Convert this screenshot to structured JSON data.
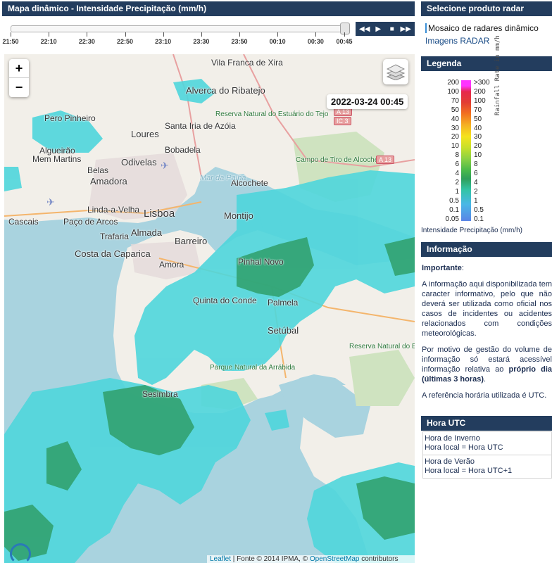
{
  "map_panel": {
    "title": "Mapa dinâmico - Intensidade Precipitação (mm/h)",
    "timeline_ticks": [
      "21:50",
      "22:10",
      "22:30",
      "22:50",
      "23:10",
      "23:30",
      "23:50",
      "00:10",
      "00:30",
      "00:45"
    ],
    "slider_position": 1.0,
    "player_buttons": [
      "rewind-icon",
      "play-icon",
      "stop-icon",
      "fast-forward-icon"
    ],
    "timestamp": "2022-03-24 00:45",
    "zoom_in": "+",
    "zoom_out": "−",
    "attribution": {
      "leaflet": "Leaflet",
      "sep1": " | Fonte © 2014 IPMA, © ",
      "osm": "OpenStreetMap",
      "tail": " contributors"
    },
    "places": {
      "vila_franca": "Vila Franca de Xira",
      "alverca": "Alverca do Ribatejo",
      "santa_iria": "Santa Iria de Azóia",
      "pero_pinheiro": "Pero Pinheiro",
      "loures": "Loures",
      "odivelas": "Odivelas",
      "bobadela": "Bobadela",
      "amadora": "Amadora",
      "algueirao": "Algueirão",
      "mem_martins": "Mem Martins",
      "belas": "Belas",
      "alcochete": "Alcochete",
      "lisboa": "Lisboa",
      "cascais": "Cascais",
      "paco_arcos": "Paço de Arcos",
      "linda_velha": "Linda-a-Velha",
      "trafaria": "Trafaria",
      "almada": "Almada",
      "montijo": "Montijo",
      "barreiro": "Barreiro",
      "costa_caparica": "Costa da Caparica",
      "amora": "Amora",
      "pinhal_novo": "Pinhal Novo",
      "quinta_conde": "Quinta do Conde",
      "palmela": "Palmela",
      "setubal": "Setúbal",
      "mar_palha": "Mar da Palha",
      "campo_tiro": "Campo de Tiro de Alcochete",
      "reserva_tejo": "Reserva Natural do Estuário do Tejo",
      "reserva_sado": "Reserva Natural do Estuário do Sado",
      "parque_arrabida": "Parque Natural da Arrábida",
      "sesimbra": "Sesimbra"
    },
    "road_shields": [
      "A 13",
      "IC 3",
      "A 13"
    ]
  },
  "product_panel": {
    "title": "Selecione produto radar",
    "links": [
      "Mosaico de radares dinâmico",
      "Imagens RADAR"
    ],
    "active_index": 0
  },
  "legend_panel": {
    "title": "Legenda",
    "left_scale": [
      "200",
      "100",
      "70",
      "50",
      "40",
      "30",
      "20",
      "10",
      "8",
      "6",
      "4",
      "2",
      "1",
      "0.5",
      "0.1",
      "0.05"
    ],
    "right_scale": [
      ">300",
      "200",
      "100",
      "70",
      "50",
      "40",
      "30",
      "20",
      "10",
      "8",
      "6",
      "4",
      "2",
      "1",
      "0.5",
      "0.1"
    ],
    "unit_label": "Rainfall Rate in mm/h",
    "caption": "Intensidade Precipitação (mm/h)"
  },
  "info_panel": {
    "title": "Informação",
    "important_label": "Importante",
    "p1": "A informação aqui disponibilizada tem caracter informativo, pelo que não deverá ser utilizada como oficial nos casos de incidentes ou acidentes relacionados com condições meteorológicas.",
    "p2_pre": "Por motivo de gestão do volume de informação só estará acessível informação relativa ao ",
    "p2_bold": "próprio dia (últimas 3 horas)",
    "p2_post": ".",
    "p3": "A referência horária utilizada é UTC."
  },
  "utc_panel": {
    "title": "Hora UTC",
    "winter_title": "Hora de Inverno",
    "winter_value": "Hora local = Hora UTC",
    "summer_title": "Hora de Verão",
    "summer_value": "Hora local = Hora UTC+1"
  },
  "colors": {
    "header_bg": "#233d5e",
    "sea": "#a9d3df",
    "land": "#f2efe9",
    "radar_light": "#4fd6dc",
    "radar_dark": "#2f9f6a"
  }
}
